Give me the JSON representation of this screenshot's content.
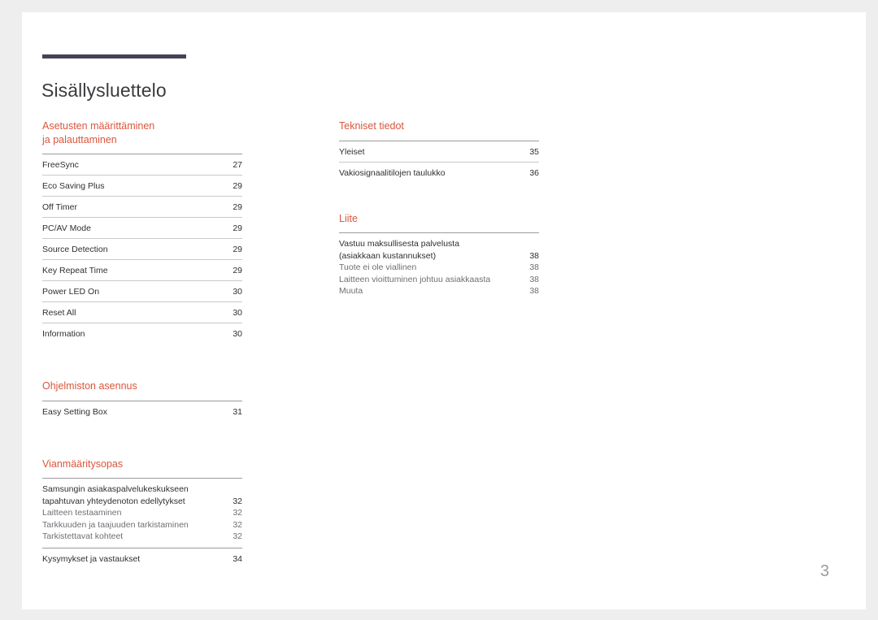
{
  "document": {
    "title": "Sisällysluettelo",
    "page_number": "3",
    "accent_color": "#d9563c",
    "bar_color": "#464258"
  },
  "left_column": {
    "sections": [
      {
        "heading": "Asetusten määrittäminen\nja palauttaminen",
        "entries": [
          {
            "label": "FreeSync",
            "page": "27"
          },
          {
            "label": "Eco Saving Plus",
            "page": "29"
          },
          {
            "label": "Off Timer",
            "page": "29"
          },
          {
            "label": "PC/AV Mode",
            "page": "29"
          },
          {
            "label": "Source Detection",
            "page": "29"
          },
          {
            "label": "Key Repeat Time",
            "page": "29"
          },
          {
            "label": "Power LED On",
            "page": "30"
          },
          {
            "label": "Reset All",
            "page": "30"
          },
          {
            "label": "Information",
            "page": "30"
          }
        ]
      },
      {
        "heading": "Ohjelmiston asennus",
        "entries": [
          {
            "label": "Easy Setting Box",
            "page": "31"
          }
        ]
      },
      {
        "heading": "Vianmääritysopas",
        "group_a": [
          {
            "label": "Samsungin asiakaspalvelukeskukseen",
            "page": "",
            "kind": "main"
          },
          {
            "label": "tapahtuvan yhteydenoton edellytykset",
            "page": "32",
            "kind": "main"
          },
          {
            "label": "Laitteen testaaminen",
            "page": "32",
            "kind": "sub"
          },
          {
            "label": "Tarkkuuden ja taajuuden tarkistaminen",
            "page": "32",
            "kind": "sub"
          },
          {
            "label": "Tarkistettavat kohteet",
            "page": "32",
            "kind": "sub"
          }
        ],
        "group_b": [
          {
            "label": "Kysymykset ja vastaukset",
            "page": "34",
            "kind": "main"
          }
        ]
      }
    ]
  },
  "right_column": {
    "sections": [
      {
        "heading": "Tekniset tiedot",
        "entries": [
          {
            "label": "Yleiset",
            "page": "35"
          },
          {
            "label": "Vakiosignaalitilojen taulukko",
            "page": "36"
          }
        ]
      },
      {
        "heading": "Liite",
        "group_a": [
          {
            "label": "Vastuu maksullisesta palvelusta",
            "page": "",
            "kind": "main"
          },
          {
            "label": "(asiakkaan kustannukset)",
            "page": "38",
            "kind": "main"
          },
          {
            "label": "Tuote ei ole viallinen",
            "page": "38",
            "kind": "sub"
          },
          {
            "label": "Laitteen vioittuminen johtuu asiakkaasta",
            "page": "38",
            "kind": "sub"
          },
          {
            "label": "Muuta",
            "page": "38",
            "kind": "sub"
          }
        ]
      }
    ]
  }
}
